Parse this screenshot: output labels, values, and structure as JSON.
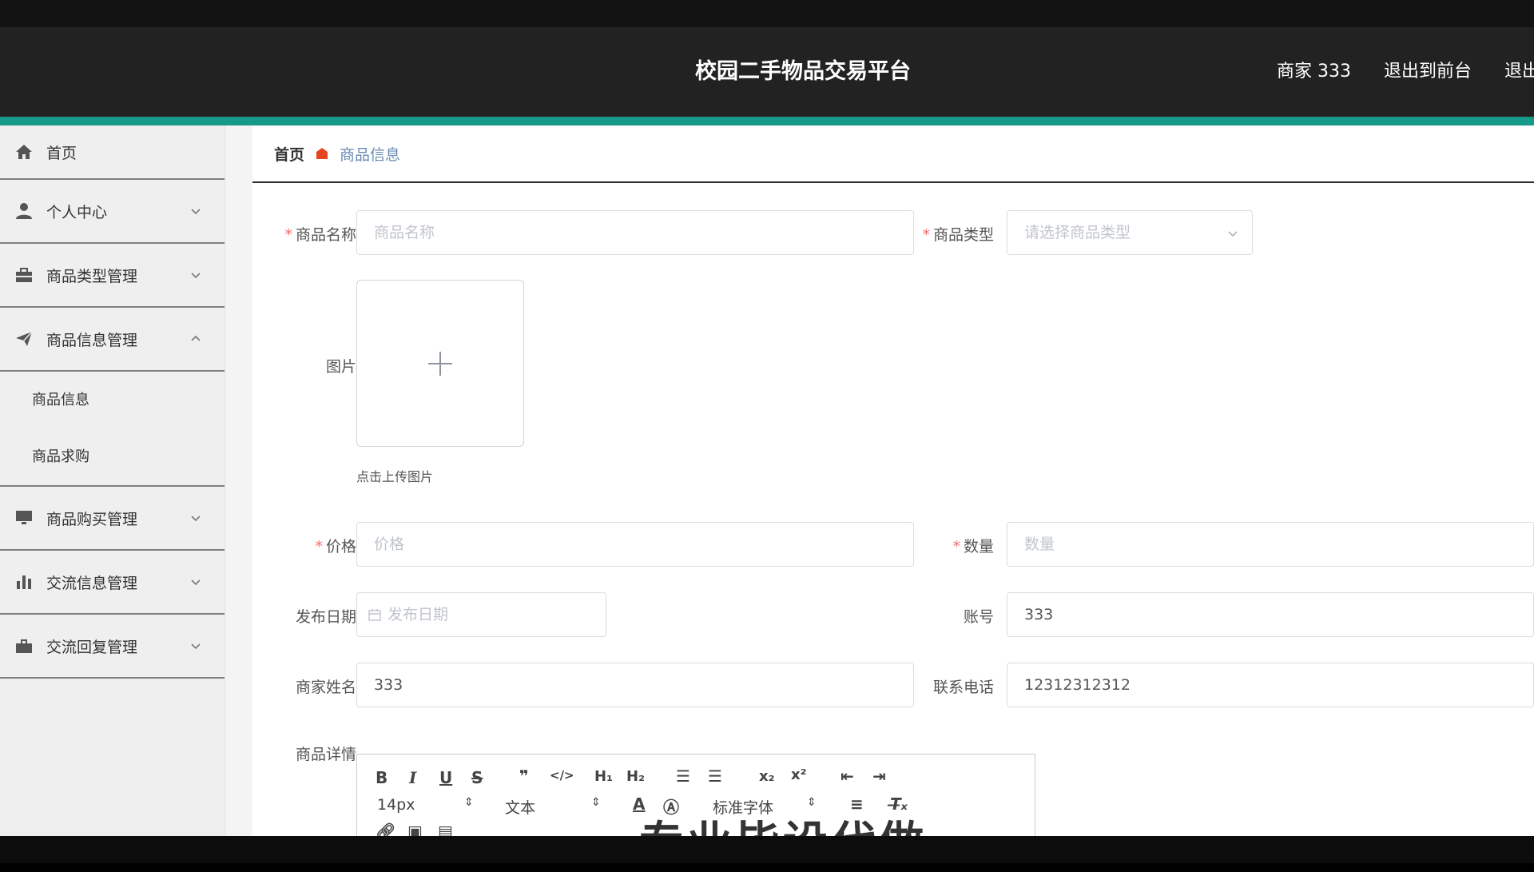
{
  "header": {
    "title": "校园二手物品交易平台",
    "user": "商家 333",
    "exit_front": "退出到前台",
    "logout": "退出登录"
  },
  "sidebar": {
    "items": [
      {
        "label": "首页",
        "icon": "home-icon"
      },
      {
        "label": "个人中心",
        "icon": "user-icon"
      },
      {
        "label": "商品类型管理",
        "icon": "briefcase-icon"
      },
      {
        "label": "商品信息管理",
        "icon": "send-icon",
        "expanded": true,
        "children": [
          {
            "label": "商品信息"
          },
          {
            "label": "商品求购"
          }
        ]
      },
      {
        "label": "商品购买管理",
        "icon": "monitor-icon"
      },
      {
        "label": "交流信息管理",
        "icon": "bar-chart-icon"
      },
      {
        "label": "交流回复管理",
        "icon": "suitcase-icon"
      }
    ]
  },
  "breadcrumb": {
    "home": "首页",
    "current": "商品信息",
    "sep_color": "#e6461f"
  },
  "form": {
    "name": {
      "label": "商品名称",
      "placeholder": "商品名称"
    },
    "type": {
      "label": "商品类型",
      "placeholder": "请选择商品类型"
    },
    "image": {
      "label": "图片",
      "tip": "点击上传图片"
    },
    "price": {
      "label": "价格",
      "placeholder": "价格"
    },
    "quantity": {
      "label": "数量",
      "placeholder": "数量"
    },
    "publish_date": {
      "label": "发布日期",
      "placeholder": "发布日期"
    },
    "account": {
      "label": "账号",
      "value": "333"
    },
    "merchant_name": {
      "label": "商家姓名",
      "value": "333"
    },
    "phone": {
      "label": "联系电话",
      "value": "12312312312"
    },
    "details": {
      "label": "商品详情"
    }
  },
  "editor": {
    "font_size": "14px",
    "block_type": "文本",
    "font_family": "标准字体"
  },
  "overlay": "专业毕设代做",
  "colors": {
    "accent": "#17998a",
    "required": "#f56c6c",
    "header_bg": "#222222"
  }
}
